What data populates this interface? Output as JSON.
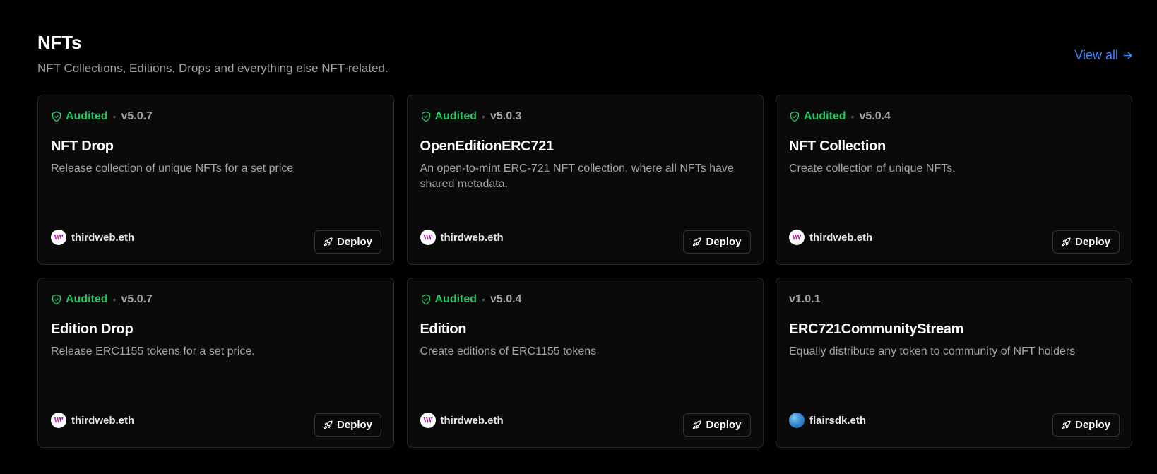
{
  "section": {
    "title": "NFTs",
    "subtitle": "NFT Collections, Editions, Drops and everything else NFT-related.",
    "view_all": "View all"
  },
  "colors": {
    "audited": "#22c55e",
    "link": "#3b82f6",
    "card_bg": "#0a0a0a",
    "border": "#262626"
  },
  "deploy_label": "Deploy",
  "cards": [
    {
      "audited": true,
      "audited_label": "Audited",
      "version": "v5.0.7",
      "title": "NFT Drop",
      "description": "Release collection of unique NFTs for a set price",
      "publisher": "thirdweb.eth",
      "avatar_icon": "thirdweb-logo-icon"
    },
    {
      "audited": true,
      "audited_label": "Audited",
      "version": "v5.0.3",
      "title": "OpenEditionERC721",
      "description": "An open-to-mint ERC-721 NFT collection, where all NFTs have shared metadata.",
      "publisher": "thirdweb.eth",
      "avatar_icon": "thirdweb-logo-icon"
    },
    {
      "audited": true,
      "audited_label": "Audited",
      "version": "v5.0.4",
      "title": "NFT Collection",
      "description": "Create collection of unique NFTs.",
      "publisher": "thirdweb.eth",
      "avatar_icon": "thirdweb-logo-icon"
    },
    {
      "audited": true,
      "audited_label": "Audited",
      "version": "v5.0.7",
      "title": "Edition Drop",
      "description": "Release ERC1155 tokens for a set price.",
      "publisher": "thirdweb.eth",
      "avatar_icon": "thirdweb-logo-icon"
    },
    {
      "audited": true,
      "audited_label": "Audited",
      "version": "v5.0.4",
      "title": "Edition",
      "description": "Create editions of ERC1155 tokens",
      "publisher": "thirdweb.eth",
      "avatar_icon": "thirdweb-logo-icon"
    },
    {
      "audited": false,
      "audited_label": "",
      "version": "v1.0.1",
      "title": "ERC721CommunityStream",
      "description": "Equally distribute any token to community of NFT holders",
      "publisher": "flairsdk.eth",
      "avatar_icon": "flair-avatar-icon"
    }
  ]
}
